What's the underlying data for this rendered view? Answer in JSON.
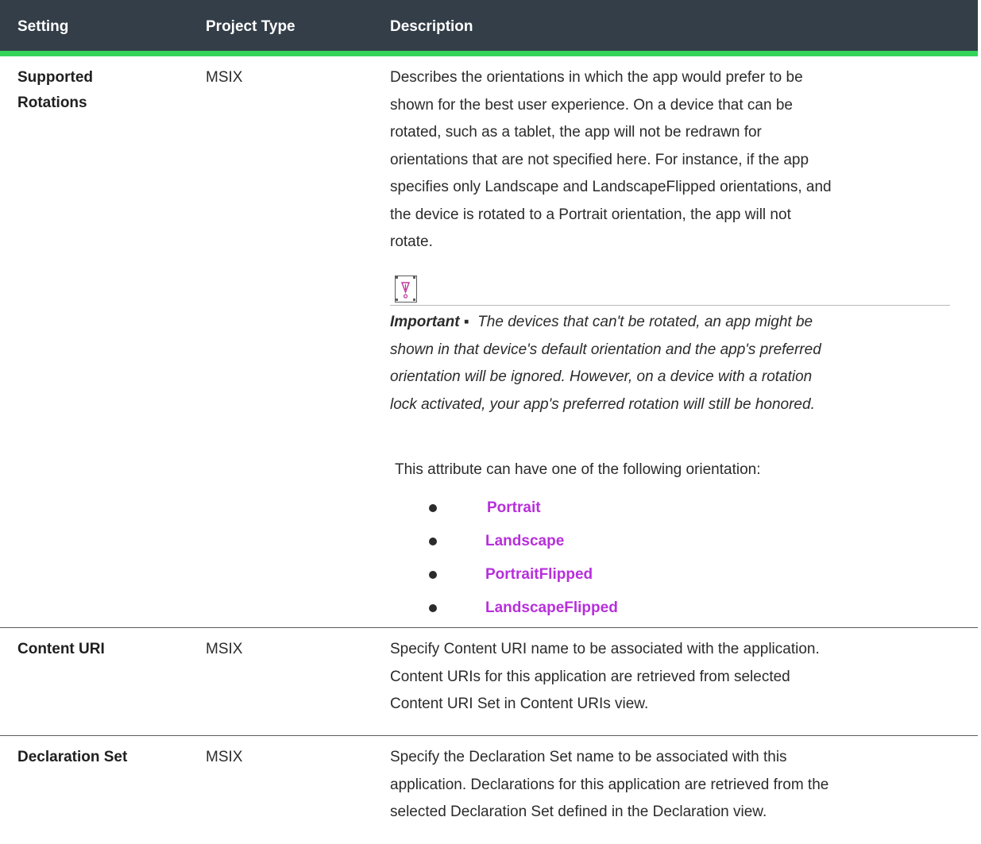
{
  "table": {
    "headers": {
      "setting": "Setting",
      "project_type": "Project Type",
      "description": "Description"
    },
    "rows": [
      {
        "setting_line1": "Supported",
        "setting_line2": "Rotations",
        "project_type": "MSIX",
        "description_lines": [
          "Describes the orientations in which the app would prefer to be",
          "shown for the best user experience. On a device that can be",
          "rotated, such as a tablet, the app will not be redrawn for",
          "orientations that are not specified here. For instance, if the app",
          "specifies only Landscape and LandscapeFlipped orientations, and",
          "the device is rotated to a Portrait orientation, the app will not",
          "rotate."
        ],
        "note": {
          "icon": "important-icon",
          "label": "Important ▪",
          "lines": [
            "The devices that can't be rotated, an app might be",
            "shown in that device's default orientation and the app's preferred",
            "orientation will be ignored. However, on a device with a rotation",
            "lock activated, your app's preferred rotation will still be honored."
          ]
        },
        "list_intro": "This attribute can have one of the following orientation:",
        "options": [
          "Portrait",
          "Landscape",
          "PortraitFlipped",
          "LandscapeFlipped"
        ]
      },
      {
        "setting": "Content URI",
        "project_type": "MSIX",
        "description_lines": [
          "Specify Content URI name to be associated with the application.",
          "Content URIs for this application are retrieved from selected",
          "Content URI Set in Content URIs view."
        ]
      },
      {
        "setting": "Declaration Set",
        "project_type": "MSIX",
        "description_lines": [
          "Specify the Declaration Set name to be associated with this",
          "application. Declarations for this application are retrieved from the",
          "selected Declaration Set defined in the Declaration view."
        ]
      }
    ]
  },
  "colors": {
    "header_bg": "#333e48",
    "header_rule": "#34d45a",
    "link": "#b72fdb",
    "note_icon_accent": "#c0369a"
  }
}
